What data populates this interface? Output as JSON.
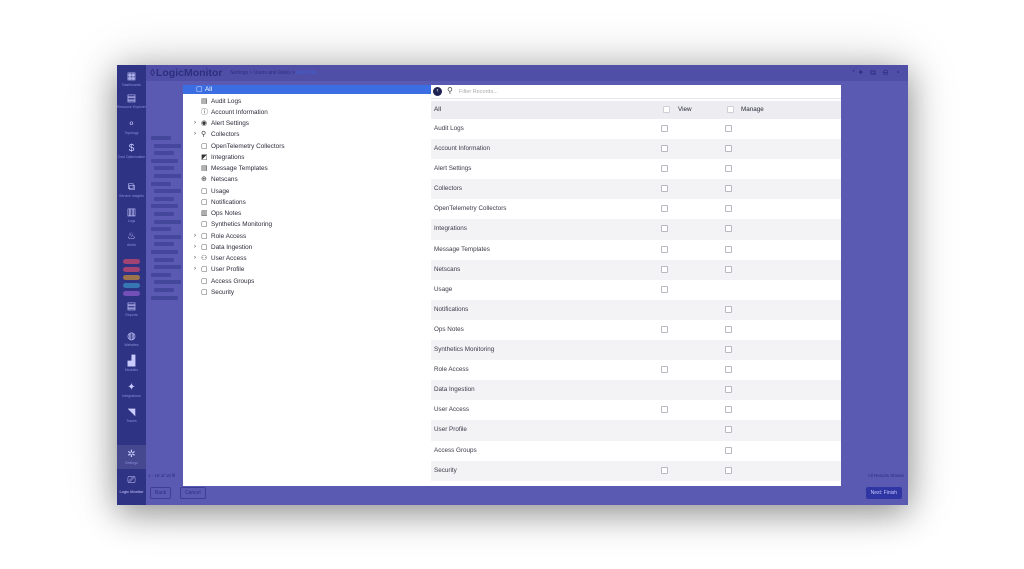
{
  "app": {
    "logo": "LogicMonitor",
    "breadcrumb": [
      "Settings",
      "Users and Roles",
      "Add Role"
    ],
    "top_icons": "⁺✦ ⧉ ⊖ ◔"
  },
  "leftnav": {
    "items": [
      {
        "label": "Dashboards",
        "icon": "▦"
      },
      {
        "label": "Resource Explorer",
        "icon": "▤"
      },
      {
        "label": "Topology",
        "icon": "⚬"
      },
      {
        "label": "Cost Optimization",
        "icon": "$"
      },
      {
        "label": "Service Insights",
        "icon": "⧉"
      },
      {
        "label": "Logs",
        "icon": "▥"
      },
      {
        "label": "Alerts",
        "icon": "♨"
      },
      {
        "label": "Reports",
        "icon": "▤"
      },
      {
        "label": "Websites",
        "icon": "◍"
      },
      {
        "label": "Modules",
        "icon": "▟"
      },
      {
        "label": "Integrations",
        "icon": "✦"
      },
      {
        "label": "Traces",
        "icon": "◥"
      },
      {
        "label": "Settings",
        "icon": "✲"
      },
      {
        "label": "",
        "icon": "⎚"
      }
    ],
    "pill_colors": [
      "#c94a6e",
      "#c94a6e",
      "#c08a3a",
      "#3a8fc0",
      "#8a5bc9"
    ],
    "footer": "Logic Monitor"
  },
  "bottom": {
    "pager": "1 - 18 of 18 Ⅲ",
    "back": "Back",
    "cancel": "Cancel",
    "results": "All Results Shown",
    "next": "Next: Finish"
  },
  "tree": {
    "items": [
      {
        "label": "All",
        "icon": "▢",
        "caret": "",
        "indent": 0
      },
      {
        "label": "Audit Logs",
        "icon": "▤",
        "caret": "",
        "indent": 1
      },
      {
        "label": "Account Information",
        "icon": "ⓘ",
        "caret": "",
        "indent": 1
      },
      {
        "label": "Alert Settings",
        "icon": "◉",
        "caret": "›",
        "indent": 1
      },
      {
        "label": "Collectors",
        "icon": "⚲",
        "caret": "›",
        "indent": 1
      },
      {
        "label": "OpenTelemetry Collectors",
        "icon": "▢",
        "caret": "",
        "indent": 1
      },
      {
        "label": "Integrations",
        "icon": "◩",
        "caret": "",
        "indent": 1
      },
      {
        "label": "Message Templates",
        "icon": "▤",
        "caret": "",
        "indent": 1
      },
      {
        "label": "Netscans",
        "icon": "⊕",
        "caret": "",
        "indent": 1
      },
      {
        "label": "Usage",
        "icon": "▢",
        "caret": "",
        "indent": 1
      },
      {
        "label": "Notifications",
        "icon": "▢",
        "caret": "",
        "indent": 1
      },
      {
        "label": "Ops Notes",
        "icon": "▥",
        "caret": "",
        "indent": 1
      },
      {
        "label": "Synthetics Monitoring",
        "icon": "▢",
        "caret": "",
        "indent": 1
      },
      {
        "label": "Role Access",
        "icon": "▢",
        "caret": "›",
        "indent": 1
      },
      {
        "label": "Data Ingestion",
        "icon": "▢",
        "caret": "›",
        "indent": 1
      },
      {
        "label": "User Access",
        "icon": "⚇",
        "caret": "›",
        "indent": 1
      },
      {
        "label": "User Profile",
        "icon": "▢",
        "caret": "›",
        "indent": 1
      },
      {
        "label": "Access Groups",
        "icon": "▢",
        "caret": "",
        "indent": 1
      },
      {
        "label": "Security",
        "icon": "▢",
        "caret": "",
        "indent": 1
      }
    ]
  },
  "filter": {
    "placeholder": "Filter Records..."
  },
  "table": {
    "header": {
      "name": "All",
      "view": "View",
      "manage": "Manage"
    },
    "rows": [
      {
        "name": "Audit Logs",
        "view": true,
        "manage": true
      },
      {
        "name": "Account Information",
        "view": true,
        "manage": true
      },
      {
        "name": "Alert Settings",
        "view": true,
        "manage": true
      },
      {
        "name": "Collectors",
        "view": true,
        "manage": true
      },
      {
        "name": "OpenTelemetry Collectors",
        "view": true,
        "manage": true
      },
      {
        "name": "Integrations",
        "view": true,
        "manage": true
      },
      {
        "name": "Message Templates",
        "view": true,
        "manage": true
      },
      {
        "name": "Netscans",
        "view": true,
        "manage": true
      },
      {
        "name": "Usage",
        "view": true,
        "manage": false
      },
      {
        "name": "Notifications",
        "view": false,
        "manage": true
      },
      {
        "name": "Ops Notes",
        "view": true,
        "manage": true
      },
      {
        "name": "Synthetics Monitoring",
        "view": false,
        "manage": true
      },
      {
        "name": "Role Access",
        "view": true,
        "manage": true
      },
      {
        "name": "Data Ingestion",
        "view": false,
        "manage": true
      },
      {
        "name": "User Access",
        "view": true,
        "manage": true
      },
      {
        "name": "User Profile",
        "view": false,
        "manage": true
      },
      {
        "name": "Access Groups",
        "view": false,
        "manage": true
      },
      {
        "name": "Security",
        "view": true,
        "manage": true
      }
    ]
  }
}
